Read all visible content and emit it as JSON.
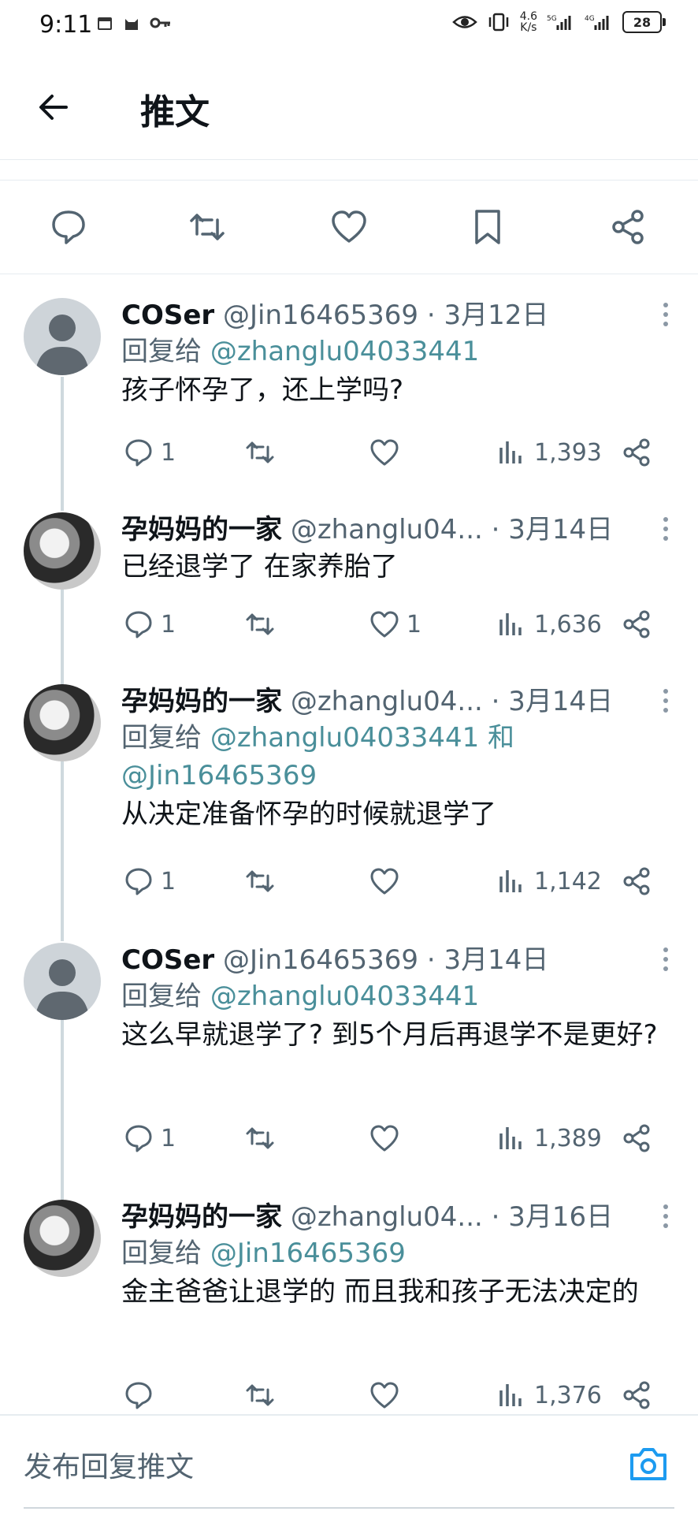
{
  "status": {
    "time": "9:11",
    "speed": [
      "4.6",
      "K/s"
    ],
    "battery": "28"
  },
  "header": {
    "title": "推文"
  },
  "compose": {
    "placeholder": "发布回复推文"
  },
  "tweets": [
    {
      "name": "COSer",
      "handle": "@Jin16465369",
      "date": "· 3月12日",
      "reply_prefix": "回复给 ",
      "reply_to": "@zhanglu04033441",
      "text": "孩子怀孕了，还上学吗?",
      "replies": "1",
      "likes": "",
      "views": "1,393"
    },
    {
      "name": "孕妈妈的一家",
      "handle": "@zhanglu04...",
      "date": "· 3月14日",
      "text": "已经退学了 在家养胎了",
      "replies": "1",
      "likes": "1",
      "views": "1,636"
    },
    {
      "name": "孕妈妈的一家",
      "handle": "@zhanglu04...",
      "date": "· 3月14日",
      "reply_prefix": "回复给 ",
      "reply_to": "@zhanglu04033441",
      "reply_and": " 和",
      "reply_to2": "@Jin16465369",
      "text": "从决定准备怀孕的时候就退学了",
      "replies": "1",
      "likes": "",
      "views": "1,142"
    },
    {
      "name": "COSer",
      "handle": "@Jin16465369",
      "date": "· 3月14日",
      "reply_prefix": "回复给 ",
      "reply_to": "@zhanglu04033441",
      "text": "这么早就退学了? 到5个月后再退学不是更好?",
      "replies": "1",
      "likes": "",
      "views": "1,389"
    },
    {
      "name": "孕妈妈的一家",
      "handle": "@zhanglu04...",
      "date": "· 3月16日",
      "reply_prefix": "回复给 ",
      "reply_to": "@Jin16465369",
      "text": "金主爸爸让退学的 而且我和孩子无法决定的",
      "replies": "",
      "likes": "",
      "views": "1,376"
    }
  ]
}
